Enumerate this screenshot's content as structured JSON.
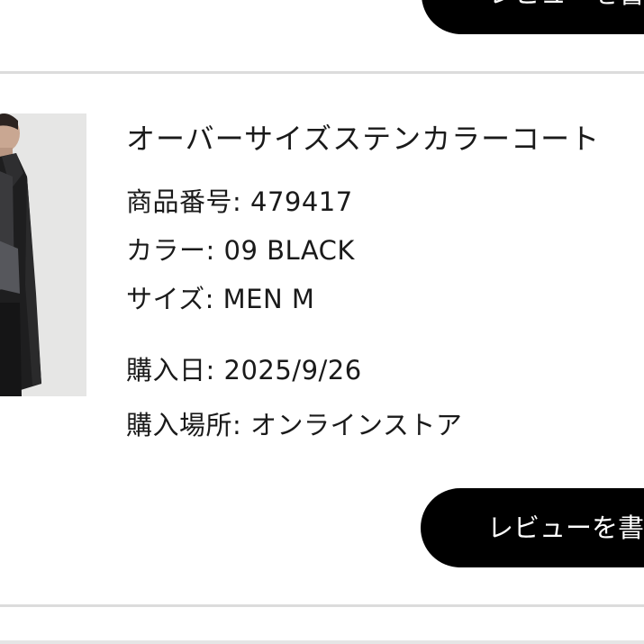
{
  "review_button_label": "レビューを書く",
  "product": {
    "name": "オーバーサイズステンカラーコート",
    "item_number_label": "商品番号:",
    "item_number": "479417",
    "color_label": "カラー:",
    "color": "09 BLACK",
    "size_label": "サイズ:",
    "size": "MEN M",
    "purchase_date_label": "購入日:",
    "purchase_date": "2025/9/26",
    "purchase_place_label": "購入場所:",
    "purchase_place": "オンラインストア"
  },
  "colors": {
    "button_bg": "#000000",
    "button_text": "#ffffff",
    "divider": "#dcdcdc",
    "text": "#1a1a1a"
  }
}
